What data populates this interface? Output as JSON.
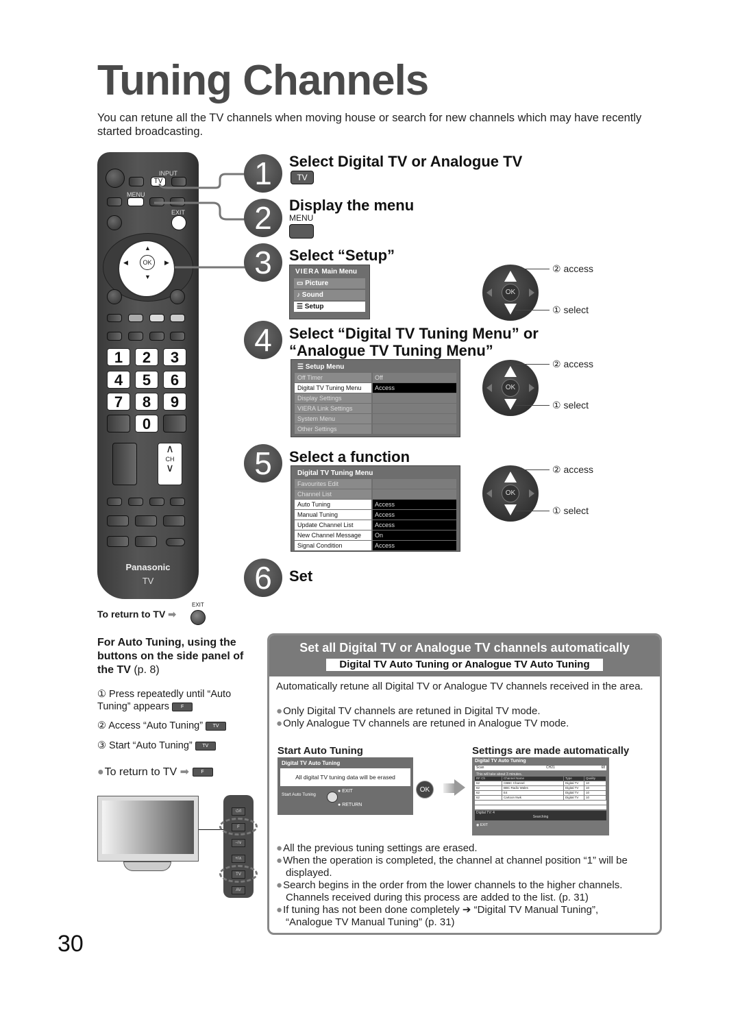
{
  "page": {
    "title": "Tuning Channels",
    "intro": "You can retune all the TV channels when moving house or search for new channels which may have recently started broadcasting.",
    "page_number": "30"
  },
  "remote": {
    "input_label": "INPUT",
    "tv_key": "TV",
    "menu_label": "MENU",
    "exit_label": "EXIT",
    "ok_label": "OK",
    "numbers": [
      "1",
      "2",
      "3",
      "4",
      "5",
      "6",
      "7",
      "8",
      "9",
      "0"
    ],
    "ch_label": "CH",
    "brand": "Panasonic",
    "model": "TV"
  },
  "steps": [
    {
      "num": "1",
      "title": "Select Digital TV or Analogue TV",
      "key": "TV"
    },
    {
      "num": "2",
      "title": "Display the menu",
      "key_label": "MENU"
    },
    {
      "num": "3",
      "title": "Select “Setup”"
    },
    {
      "num": "4",
      "title_line1": "Select “Digital TV Tuning Menu” or",
      "title_line2": "“Analogue TV Tuning Menu”"
    },
    {
      "num": "5",
      "title": "Select a function"
    },
    {
      "num": "6",
      "title": "Set"
    }
  ],
  "main_menu": {
    "brand": "VIERA",
    "title": "Main Menu",
    "items": [
      {
        "label": "Picture",
        "icon": "picture-icon"
      },
      {
        "label": "Sound",
        "icon": "music-note-icon"
      },
      {
        "label": "Setup",
        "icon": "list-icon",
        "selected": true
      }
    ]
  },
  "setup_menu": {
    "title": "Setup Menu",
    "rows": [
      {
        "label": "Off Timer",
        "value": "Off"
      },
      {
        "label": "Digital TV Tuning Menu",
        "value": "Access",
        "selected": true
      },
      {
        "label": "Display Settings",
        "value": ""
      },
      {
        "label": "VIERA Link Settings",
        "value": ""
      },
      {
        "label": "System Menu",
        "value": ""
      },
      {
        "label": "Other Settings",
        "value": ""
      }
    ]
  },
  "tuning_menu": {
    "title": "Digital TV Tuning Menu",
    "rows": [
      {
        "label": "Favourites Edit",
        "value": ""
      },
      {
        "label": "Channel List",
        "value": ""
      },
      {
        "label": "Auto Tuning",
        "value": "Access",
        "active": true
      },
      {
        "label": "Manual Tuning",
        "value": "Access",
        "active": true
      },
      {
        "label": "Update Channel List",
        "value": "Access",
        "active": true
      },
      {
        "label": "New Channel Message",
        "value": "On",
        "active": true
      },
      {
        "label": "Signal Condition",
        "value": "Access",
        "active": true
      }
    ]
  },
  "dpad": {
    "ok": "OK",
    "access": "② access",
    "select": "① select"
  },
  "return_tv": {
    "label": "To return to TV",
    "exit": "EXIT"
  },
  "side_panel": {
    "heading_bold": "For Auto Tuning, using the buttons on the side panel of the TV",
    "heading_ref": "(p. 8)",
    "steps": [
      {
        "text": "① Press repeatedly until “Auto Tuning” appears",
        "key": "F"
      },
      {
        "text": "② Access “Auto Tuning”",
        "key": "TV"
      },
      {
        "text": "③ Start “Auto Tuning”",
        "key": "TV"
      }
    ],
    "return": "To return to TV",
    "return_key": "F",
    "panel_keys": [
      "⏻/I",
      "F",
      "−/∨",
      "+/∧",
      "TV",
      "AV"
    ]
  },
  "auto": {
    "title": "Set all Digital TV or Analogue TV channels automatically",
    "subtitle": "Digital TV Auto Tuning or Analogue TV Auto Tuning",
    "desc": "Automatically retune all Digital TV or Analogue TV channels received in the area.",
    "bullets_top": [
      "Only Digital TV channels are retuned in Digital TV mode.",
      "Only Analogue TV channels are retuned in Analogue TV mode."
    ],
    "start_heading": "Start Auto Tuning",
    "settings_heading": "Settings are made automatically",
    "start_screen": {
      "title": "Digital TV Auto Tuning",
      "message": "All digital TV tuning data will be erased",
      "start_label": "Start Auto Tuning",
      "exit": "EXIT",
      "return": "RETURN",
      "ok": "OK"
    },
    "result_screen": {
      "title": "Digital TV Auto Tuning",
      "scan": "Scan",
      "ch_start": "CH21",
      "ch_end": "68",
      "note": "This will take about 3 minutes.",
      "columns": [
        "RF Ch",
        "Channel Name",
        "Type",
        "Quality"
      ],
      "rows": [
        [
          "62",
          "CBBC Channel",
          "Digital TV",
          "10"
        ],
        [
          "62",
          "BBC Radio Wales",
          "Digital TV",
          "10"
        ],
        [
          "62",
          "E4",
          "Digital TV",
          "10"
        ],
        [
          "62",
          "Cartoon Nwk",
          "Digital TV",
          "10"
        ]
      ],
      "count": "Digital TV: 4",
      "status": "Searching",
      "exit": "EXIT"
    },
    "bullets_bottom": [
      "All the previous tuning settings are erased.",
      "When the operation is completed, the channel at channel position “1” will be displayed.",
      "Search begins in the order from the lower channels to the higher channels. Channels received during this process are added to the list. (p. 31)",
      "If tuning has not been done completely ➔ “Digital TV Manual Tuning”, “Analogue TV Manual Tuning” (p. 31)"
    ]
  }
}
